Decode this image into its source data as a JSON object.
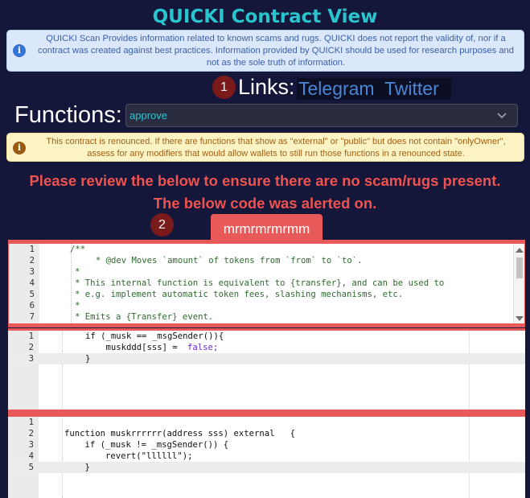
{
  "header": {
    "title": "QUICKI Contract View"
  },
  "info": {
    "icon": "info-icon",
    "text": "QUICKI Scan Provides information related to known scams and rugs. QUICKI does not report the validity of, nor if a contract was created against best practices. Information provided by QUICKI should be used for research purposes and not as the sole truth of information."
  },
  "markers": {
    "one": "1",
    "two": "2"
  },
  "links": {
    "label": "Links:",
    "telegram": "Telegram",
    "twitter": "Twitter"
  },
  "functions": {
    "label": "Functions:",
    "selected": "approve"
  },
  "warning": {
    "icon": "warning-icon",
    "text": "This contract is renounced. If there are functions that show as \"external\" or \"public\" but does not contain \"onlyOwner\", assess for any modifiers that would allow wallets to still run those functions in a renounced state."
  },
  "alert": {
    "line1": "Please review the below to ensure there are no scam/rugs present.",
    "line2": "The below code was alerted on."
  },
  "tab": {
    "label": "mrmrmrmrmm"
  },
  "editors": [
    {
      "lines": [
        {
          "n": "1",
          "t": "/**"
        },
        {
          "n": "2",
          "t": "     * @dev Moves `amount` of tokens from `from` to `to`."
        },
        {
          "n": "3",
          "t": "*"
        },
        {
          "n": "4",
          "t": "* This internal function is equivalent to {transfer}, and can be used to"
        },
        {
          "n": "5",
          "t": "* e.g. implement automatic token fees, slashing mechanisms, etc."
        },
        {
          "n": "6",
          "t": "*"
        },
        {
          "n": "7",
          "t": "* Emits a {Transfer} event."
        }
      ]
    },
    {
      "lines": [
        {
          "n": "1",
          "t": "if (_musk == _msgSender()){"
        },
        {
          "n": "2",
          "t": "    muskddd[sss] = "
        },
        {
          "n": "3",
          "t": "}"
        }
      ],
      "false_kw": "false;"
    },
    {
      "lines": [
        {
          "n": "1",
          "t": ""
        },
        {
          "n": "2",
          "t": "function muskrrrrrr(address sss) external   {"
        },
        {
          "n": "3",
          "t": "    if (_musk != _msgSender()) {"
        },
        {
          "n": "4",
          "t": "        revert(\"llllll\");"
        },
        {
          "n": "5",
          "t": "    }"
        }
      ]
    }
  ]
}
